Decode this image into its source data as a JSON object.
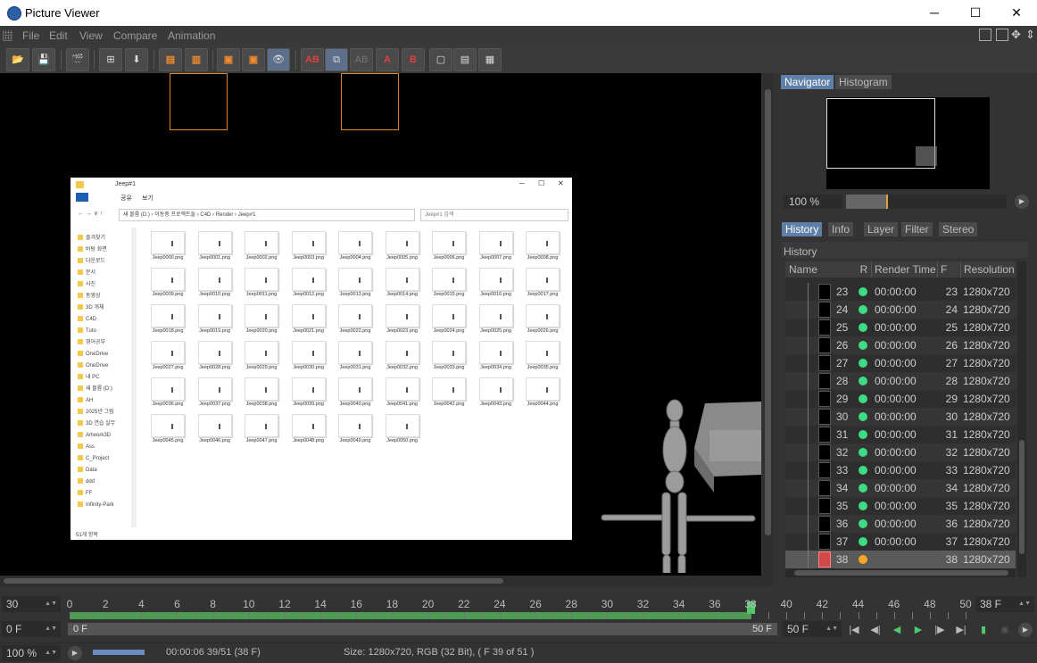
{
  "window": {
    "title": "Picture Viewer",
    "minimize_icon": "─",
    "maximize_icon": "☐",
    "close_icon": "✕"
  },
  "menu": [
    "File",
    "Edit",
    "View",
    "Compare",
    "Animation"
  ],
  "toolbar": {
    "ab_label": "AB",
    "ab_dim_label": "AB",
    "a_label": "A",
    "b_label": "B"
  },
  "explorer": {
    "title": "Jeep#1",
    "tabs": [
      "공유",
      "보기"
    ],
    "address": "새 볼륨 (D:) › 이동중 프로젝트들 › C4D › Render › Jeep#1",
    "search_placeholder": "Jeep#1 검색",
    "sidebar": [
      "즐겨찾기",
      "바탕 화면",
      "다운로드",
      "문서",
      "사진",
      "동영상",
      "3D 개체",
      "C4D",
      "Tuto",
      "영어공부",
      "OneDrive",
      "OneDrive",
      "내 PC",
      "새 볼륨 (D:)",
      "AH",
      "2025년 그림",
      "3D 연습 실무",
      "Artwork3D",
      "Ass",
      "C_Project",
      "Data",
      "ddd",
      "FF",
      "Infinity-Park"
    ],
    "footer": "51개 항목",
    "files": [
      "Jeep0000.png",
      "Jeep0001.png",
      "Jeep0002.png",
      "Jeep0003.png",
      "Jeep0004.png",
      "Jeep0005.png",
      "Jeep0006.png",
      "Jeep0007.png",
      "Jeep0008.png",
      "Jeep0009.png",
      "Jeep0010.png",
      "Jeep0011.png",
      "Jeep0012.png",
      "Jeep0013.png",
      "Jeep0014.png",
      "Jeep0015.png",
      "Jeep0016.png",
      "Jeep0017.png",
      "Jeep0018.png",
      "Jeep0019.png",
      "Jeep0020.png",
      "Jeep0021.png",
      "Jeep0022.png",
      "Jeep0023.png",
      "Jeep0024.png",
      "Jeep0025.png",
      "Jeep0026.png",
      "Jeep0027.png",
      "Jeep0028.png",
      "Jeep0029.png",
      "Jeep0030.png",
      "Jeep0031.png",
      "Jeep0032.png",
      "Jeep0033.png",
      "Jeep0034.png",
      "Jeep0035.png",
      "Jeep0036.png",
      "Jeep0037.png",
      "Jeep0038.png",
      "Jeep0039.png",
      "Jeep0040.png",
      "Jeep0041.png",
      "Jeep0042.png",
      "Jeep0043.png",
      "Jeep0044.png",
      "Jeep0045.png",
      "Jeep0046.png",
      "Jeep0047.png",
      "Jeep0048.png",
      "Jeep0049.png",
      "Jeep0050.png"
    ]
  },
  "navigator": {
    "tabs": [
      "Navigator",
      "Histogram"
    ],
    "zoom": "100 %"
  },
  "history": {
    "tabs": [
      "History",
      "Info",
      "Layer",
      "Filter",
      "Stereo"
    ],
    "title": "History",
    "columns": [
      "Name",
      "R",
      "Render Time",
      "F",
      "Resolution"
    ],
    "rows": [
      {
        "name": "23",
        "time": "00:00:00",
        "frame": "23",
        "res": "1280x720",
        "status": "done"
      },
      {
        "name": "24",
        "time": "00:00:00",
        "frame": "24",
        "res": "1280x720",
        "status": "done"
      },
      {
        "name": "25",
        "time": "00:00:00",
        "frame": "25",
        "res": "1280x720",
        "status": "done"
      },
      {
        "name": "26",
        "time": "00:00:00",
        "frame": "26",
        "res": "1280x720",
        "status": "done"
      },
      {
        "name": "27",
        "time": "00:00:00",
        "frame": "27",
        "res": "1280x720",
        "status": "done"
      },
      {
        "name": "28",
        "time": "00:00:00",
        "frame": "28",
        "res": "1280x720",
        "status": "done"
      },
      {
        "name": "29",
        "time": "00:00:00",
        "frame": "29",
        "res": "1280x720",
        "status": "done"
      },
      {
        "name": "30",
        "time": "00:00:00",
        "frame": "30",
        "res": "1280x720",
        "status": "done"
      },
      {
        "name": "31",
        "time": "00:00:00",
        "frame": "31",
        "res": "1280x720",
        "status": "done"
      },
      {
        "name": "32",
        "time": "00:00:00",
        "frame": "32",
        "res": "1280x720",
        "status": "done"
      },
      {
        "name": "33",
        "time": "00:00:00",
        "frame": "33",
        "res": "1280x720",
        "status": "done"
      },
      {
        "name": "34",
        "time": "00:00:00",
        "frame": "34",
        "res": "1280x720",
        "status": "done"
      },
      {
        "name": "35",
        "time": "00:00:00",
        "frame": "35",
        "res": "1280x720",
        "status": "done"
      },
      {
        "name": "36",
        "time": "00:00:00",
        "frame": "36",
        "res": "1280x720",
        "status": "done"
      },
      {
        "name": "37",
        "time": "00:00:00",
        "frame": "37",
        "res": "1280x720",
        "status": "done"
      },
      {
        "name": "38",
        "time": "",
        "frame": "38",
        "res": "1280x720",
        "status": "rendering"
      }
    ],
    "status_colors": {
      "done": "#3ddc84",
      "rendering": "#f5a623"
    }
  },
  "timeline": {
    "fps": "30",
    "ticks": [
      "0",
      "2",
      "4",
      "6",
      "8",
      "10",
      "12",
      "14",
      "16",
      "18",
      "20",
      "22",
      "24",
      "26",
      "28",
      "30",
      "32",
      "34",
      "36",
      "38",
      "40",
      "42",
      "44",
      "46",
      "48",
      "50"
    ],
    "current_frame": 38,
    "max_frame": 50,
    "current_field": "38 F",
    "start_field": "0 F",
    "range_start": "0 F",
    "range_end": "50 F",
    "end_field": "50 F"
  },
  "status": {
    "zoom": "100 %",
    "progress": 0.765,
    "time": "00:00:06 39/51 (38 F)",
    "info": "Size: 1280x720, RGB (32 Bit),  ( F 39 of 51 )"
  }
}
